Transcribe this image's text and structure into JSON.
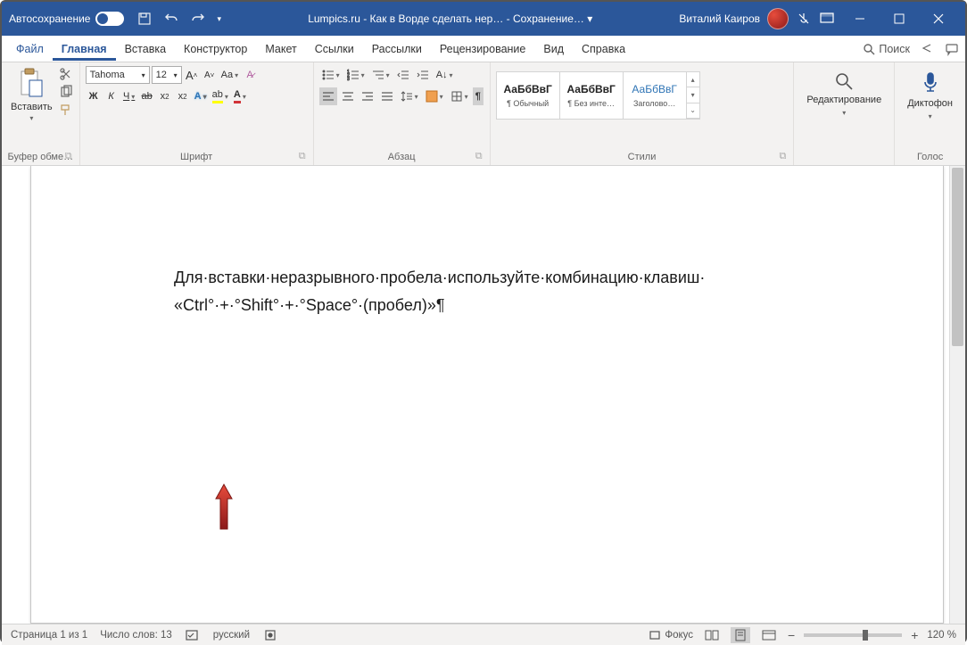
{
  "titlebar": {
    "autosave_label": "Автосохранение",
    "title": "Lumpics.ru - Как в Ворде сделать нер…  - Сохранение… ▾",
    "user": "Виталий Каиров"
  },
  "tabs": {
    "file": "Файл",
    "items": [
      "Главная",
      "Вставка",
      "Конструктор",
      "Макет",
      "Ссылки",
      "Рассылки",
      "Рецензирование",
      "Вид",
      "Справка"
    ],
    "search": "Поиск"
  },
  "ribbon": {
    "clipboard": {
      "paste": "Вставить",
      "label": "Буфер обме…"
    },
    "font": {
      "name": "Tahoma",
      "size": "12",
      "bold": "Ж",
      "italic": "К",
      "underline": "Ч",
      "strike": "ab",
      "label": "Шрифт"
    },
    "paragraph": {
      "label": "Абзац"
    },
    "styles": {
      "preview": "АаБбВвГ",
      "items": [
        "¶ Обычный",
        "¶ Без инте…",
        "Заголово…"
      ],
      "label": "Стили"
    },
    "editing": {
      "label": "Редактирование"
    },
    "voice": {
      "btn": "Диктофон",
      "label": "Голос"
    }
  },
  "document": {
    "line1": "Для·вставки·неразрывного·пробела·используйте·комбинацию·клавиш·",
    "line2": "«Ctrl°·+·°Shift°·+·°Space°·(пробел)»¶"
  },
  "statusbar": {
    "page": "Страница 1 из 1",
    "words": "Число слов: 13",
    "lang": "русский",
    "focus": "Фокус",
    "zoom": "120 %"
  }
}
